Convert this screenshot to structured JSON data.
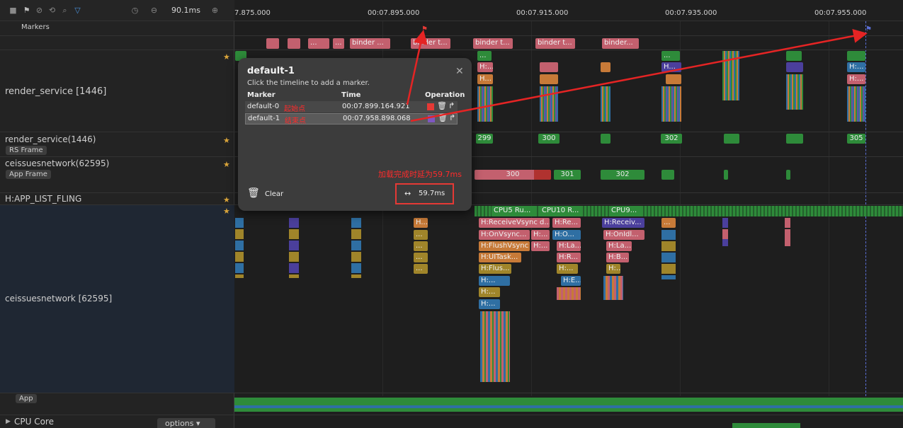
{
  "toolbar": {
    "zoom": "90.1ms"
  },
  "ruler": {
    "ticks": [
      "7.875.000",
      "00:07.895.000",
      "00:07.915.000",
      "00:07.935.000",
      "00:07.955.000"
    ]
  },
  "markers_row": {
    "label": "Markers"
  },
  "rows": {
    "render_service_main": "render_service [1446]",
    "render_service_frame": "render_service(1446)",
    "rs_frame_tag": "RS Frame",
    "ceissues_frame": "ceissuesnetwork(62595)",
    "app_frame_tag": "App Frame",
    "app_list_fling": "H:APP_LIST_FLING",
    "ceissues_main": "ceissuesnetwork [62595]",
    "app_tag": "App",
    "cpu_core": "CPU Core",
    "options": "options"
  },
  "binder": [
    "...",
    "...",
    "binder ...",
    "binder t...",
    "binder t...",
    "binder t...",
    "binder..."
  ],
  "rs_frames": [
    "299",
    "300",
    "302",
    "305"
  ],
  "app_frames": [
    "300",
    "301",
    "302"
  ],
  "cpu_labels": [
    "CPU5 Ru...",
    "CPU10 R...",
    "CPU9..."
  ],
  "slices": {
    "col1": [
      "H:ReceiveVsync d...",
      "H:OnVsync...",
      "H:FlushVsync",
      "H:UITask...",
      "H:Flus...",
      "H:...",
      "H:...",
      "H:..."
    ],
    "col2": [
      "H:Re...",
      "H:...",
      "H:...",
      "H:..."
    ],
    "col3": [
      "H:Re...",
      "H:O...",
      "H:La...",
      "H:R...",
      "H:...",
      "H:E..."
    ],
    "col4": [
      "H:Receiv...",
      "H:OnIdl...",
      "H:La...",
      "H:B...",
      "H:..."
    ],
    "short": [
      "H...",
      "...",
      "...",
      "...",
      "...",
      "..."
    ],
    "rs_top": [
      "...",
      "H:...",
      "H...",
      "...",
      "H...",
      "H:...",
      "H:..."
    ]
  },
  "popup": {
    "title": "default-1",
    "hint": "Click the timeline to add a marker.",
    "col_marker": "Marker",
    "col_time": "Time",
    "col_op": "Operation",
    "rows": [
      {
        "name": "default-0",
        "note": "起始点",
        "time": "00:07.899.164.921",
        "color": "#e53935"
      },
      {
        "name": "default-1",
        "note": "结束点",
        "time": "00:07.958.898.068",
        "color": "#7e57c2"
      }
    ],
    "clear": "Clear",
    "duration": "59.7ms",
    "annotation": "加载完成时延为59.7ms"
  }
}
